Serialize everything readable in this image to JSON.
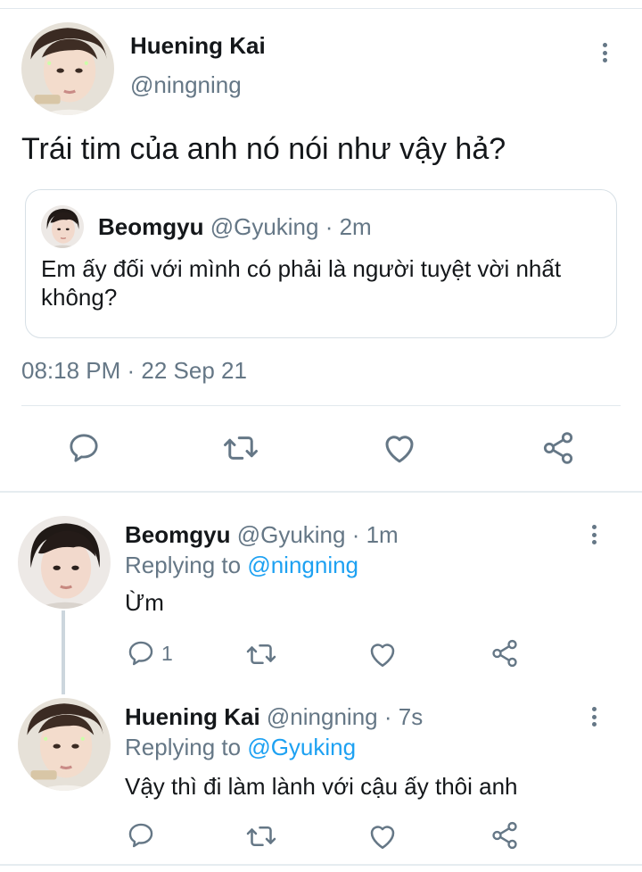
{
  "main_tweet": {
    "name": "Huening Kai",
    "handle": "@ningning",
    "text": "Trái tim của anh nó nói như vậy hả?",
    "timestamp": "08:18 PM · 22 Sep 21",
    "quoted": {
      "name": "Beomgyu",
      "handle": "@Gyuking",
      "time": "· 2m",
      "text": "Em ấy đối với mình có phải là người tuyệt vời nhất không?"
    },
    "actions": [
      "reply-icon",
      "retweet-icon",
      "like-icon",
      "share-icon"
    ]
  },
  "replies": [
    {
      "name": "Beomgyu",
      "handle": "@Gyuking",
      "time": "· 1m",
      "replying_label": "Replying to",
      "replying_to": "@ningning",
      "text": "Ừm",
      "reply_count": "1"
    },
    {
      "name": "Huening Kai",
      "handle": "@ningning",
      "time": "· 7s",
      "replying_label": "Replying to",
      "replying_to": "@Gyuking",
      "text": "Vậy thì đi làm lành với cậu ấy thôi anh",
      "reply_count": ""
    }
  ],
  "colors": {
    "text": "#14171a",
    "secondary": "#657786",
    "link": "#1da1f2",
    "divider": "#e1e8ed",
    "background": "#ffffff"
  }
}
